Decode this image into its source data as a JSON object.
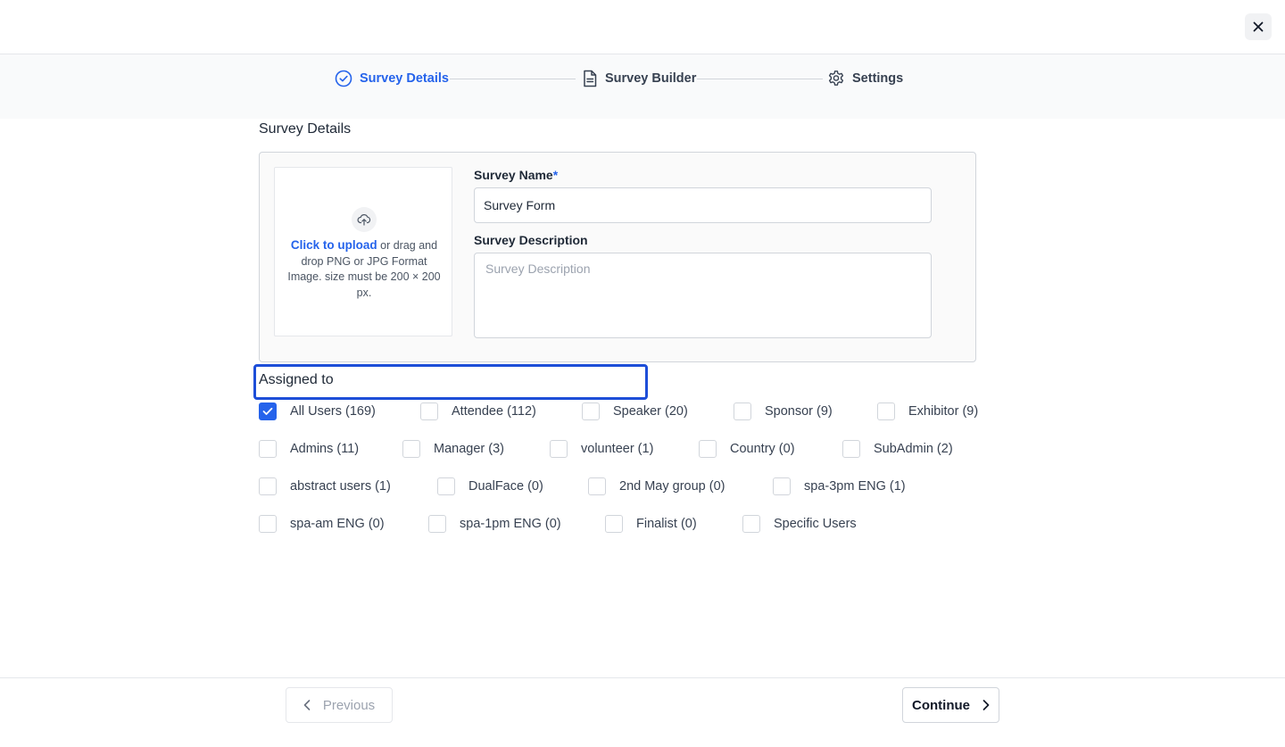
{
  "header": {
    "close_label": "×"
  },
  "stepper": {
    "steps": [
      {
        "label": "Survey Details",
        "icon": "check-circle-icon",
        "active": true
      },
      {
        "label": "Survey Builder",
        "icon": "document-icon",
        "active": false
      },
      {
        "label": "Settings",
        "icon": "gear-icon",
        "active": false
      }
    ]
  },
  "form": {
    "section_title": "Survey Details",
    "upload": {
      "link_text": "Click to upload",
      "helper_text": " or drag and drop PNG or JPG Format Image. size must be 200 × 200 px."
    },
    "survey_name": {
      "label": "Survey Name",
      "required_mark": "*",
      "value": "Survey Form"
    },
    "survey_description": {
      "label": "Survey Description",
      "placeholder": "Survey Description",
      "value": ""
    }
  },
  "assigned": {
    "label": "Assigned to",
    "options": [
      {
        "label": "All Users (169)",
        "checked": true
      },
      {
        "label": "Attendee (112)",
        "checked": false
      },
      {
        "label": "Speaker (20)",
        "checked": false
      },
      {
        "label": "Sponsor (9)",
        "checked": false
      },
      {
        "label": "Exhibitor (9)",
        "checked": false
      },
      {
        "label": "Admins (11)",
        "checked": false
      },
      {
        "label": "Manager (3)",
        "checked": false
      },
      {
        "label": "volunteer (1)",
        "checked": false
      },
      {
        "label": "Country (0)",
        "checked": false
      },
      {
        "label": "SubAdmin (2)",
        "checked": false
      },
      {
        "label": "abstract users (1)",
        "checked": false
      },
      {
        "label": "DualFace (0)",
        "checked": false
      },
      {
        "label": "2nd May group (0)",
        "checked": false
      },
      {
        "label": "spa-3pm ENG (1)",
        "checked": false
      },
      {
        "label": "spa-am ENG (0)",
        "checked": false
      },
      {
        "label": "spa-1pm ENG (0)",
        "checked": false
      },
      {
        "label": "Finalist (0)",
        "checked": false
      },
      {
        "label": "Specific Users",
        "checked": false
      }
    ]
  },
  "footer": {
    "previous_label": "Previous",
    "continue_label": "Continue"
  },
  "colors": {
    "accent": "#2563eb",
    "focus_border": "#1d4ed8",
    "muted_text": "#9ca3af"
  }
}
